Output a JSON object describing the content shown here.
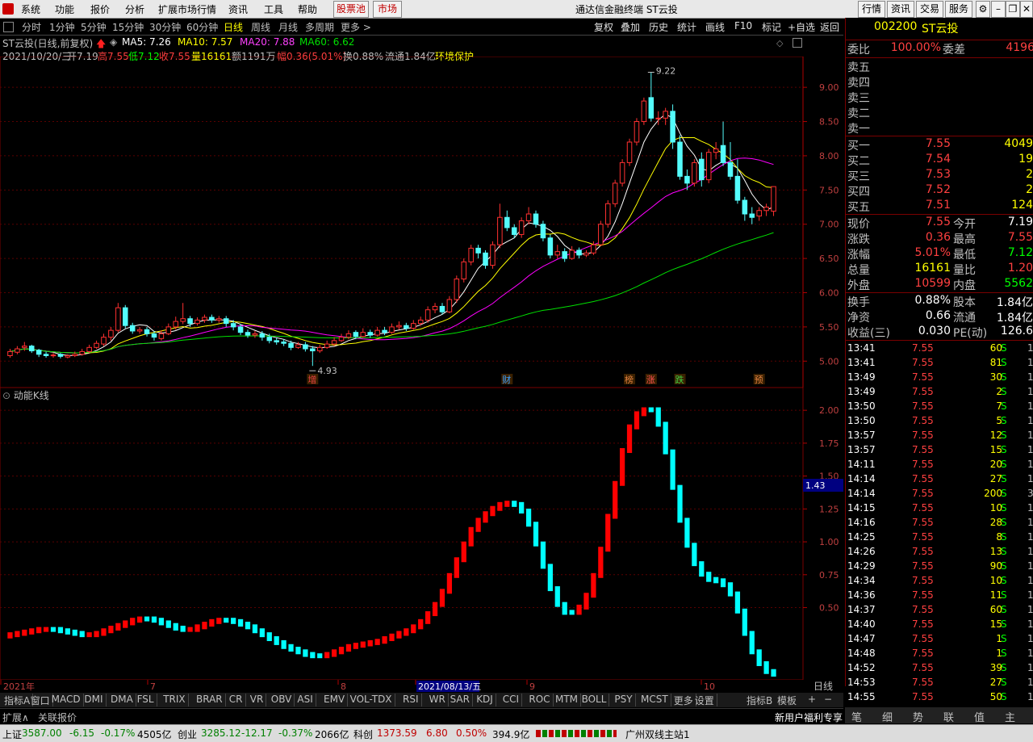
{
  "menubar": {
    "items": [
      "系统",
      "功能",
      "报价",
      "分析",
      "扩展市场行情",
      "资讯",
      "工具",
      "帮助"
    ],
    "highlight": [
      "股票池",
      "市场"
    ],
    "title": "通达信金融终端  ST云投",
    "right_buttons": [
      "行情",
      "资讯",
      "交易",
      "服务"
    ]
  },
  "toolbar": {
    "left": [
      "分时",
      "1分钟",
      "5分钟",
      "15分钟",
      "30分钟",
      "60分钟",
      "日线",
      "周线",
      "月线",
      "多周期",
      "更多 >"
    ],
    "selected": "日线",
    "right": [
      "复权",
      "叠加",
      "历史",
      "统计",
      "画线",
      "F10",
      "标记",
      "+自选",
      "返回"
    ]
  },
  "header": {
    "stock": "ST云投(日线,前复权)",
    "ma5": "MA5: 7.26",
    "ma10": "MA10: 7.57",
    "ma20": "MA20: 7.88",
    "ma60": "MA60: 6.62",
    "date": "2021/10/20/三",
    "open": "开7.19",
    "high": "高7.55",
    "low": "低7.12",
    "close": "收7.55",
    "vol": "量16161",
    "amount": "额1191万",
    "range": "幅0.36(5.01%)",
    "turnover": "换0.88%",
    "float": "流通1.84亿",
    "concept": "环境保护"
  },
  "chart_data": [
    {
      "type": "candlestick",
      "title": "ST云投(日线,前复权)",
      "ylim": [
        4.85,
        9.45
      ],
      "yticks": [
        "9.00",
        "8.50",
        "8.00",
        "7.50",
        "7.00",
        "6.50",
        "6.00",
        "5.50",
        "5.00"
      ],
      "annotations": {
        "high": "9.22",
        "low": "4.93"
      },
      "event_labels": [
        "增",
        "财",
        "榜",
        "涨",
        "跌",
        "预"
      ],
      "ma_legend": [
        "MA5",
        "MA10",
        "MA20",
        "MA60"
      ],
      "colors": {
        "up": "#ff3030",
        "down": "#54fcfc",
        "ma5": "#ffffff",
        "ma10": "#ffff00",
        "ma20": "#ff00ff",
        "ma60": "#00e000"
      },
      "closes": [
        5.14,
        5.18,
        5.22,
        5.15,
        5.1,
        5.08,
        5.09,
        5.07,
        5.08,
        5.1,
        5.14,
        5.2,
        5.26,
        5.35,
        5.45,
        5.78,
        5.52,
        5.44,
        5.46,
        5.4,
        5.35,
        5.4,
        5.5,
        5.58,
        5.62,
        5.55,
        5.6,
        5.64,
        5.6,
        5.62,
        5.55,
        5.5,
        5.42,
        5.38,
        5.4,
        5.35,
        5.3,
        5.28,
        5.26,
        5.2,
        5.24,
        5.18,
        5.15,
        5.2,
        5.25,
        5.3,
        5.35,
        5.4,
        5.36,
        5.42,
        5.38,
        5.45,
        5.42,
        5.5,
        5.52,
        5.48,
        5.55,
        5.6,
        5.75,
        5.8,
        5.72,
        5.9,
        6.2,
        6.45,
        6.65,
        6.58,
        6.4,
        6.7,
        7.1,
        6.95,
        6.85,
        7.05,
        7.15,
        7.0,
        6.8,
        6.55,
        6.6,
        6.5,
        6.62,
        6.55,
        6.58,
        6.7,
        7.0,
        7.3,
        7.6,
        7.9,
        8.2,
        8.5,
        8.8,
        8.55,
        8.55,
        8.65,
        8.2,
        7.7,
        7.6,
        7.9,
        7.65,
        8.05,
        8.1,
        7.9,
        7.7,
        7.35,
        7.15,
        7.1,
        7.2,
        7.25,
        7.55
      ],
      "opens": [
        5.08,
        5.13,
        5.2,
        5.22,
        5.16,
        5.1,
        5.08,
        5.1,
        5.06,
        5.08,
        5.1,
        5.14,
        5.2,
        5.25,
        5.35,
        5.45,
        5.78,
        5.52,
        5.44,
        5.46,
        5.4,
        5.33,
        5.4,
        5.5,
        5.58,
        5.62,
        5.55,
        5.6,
        5.64,
        5.6,
        5.62,
        5.55,
        5.5,
        5.42,
        5.38,
        5.4,
        5.35,
        5.3,
        5.28,
        5.26,
        5.2,
        5.24,
        5.18,
        5.15,
        5.2,
        5.25,
        5.3,
        5.35,
        5.42,
        5.36,
        5.42,
        5.38,
        5.45,
        5.42,
        5.5,
        5.52,
        5.48,
        5.55,
        5.6,
        5.75,
        5.8,
        5.72,
        5.9,
        6.2,
        6.45,
        6.65,
        6.58,
        6.4,
        6.7,
        7.1,
        6.95,
        6.85,
        7.05,
        7.15,
        7.0,
        6.8,
        6.55,
        6.6,
        6.5,
        6.62,
        6.55,
        6.58,
        6.7,
        7.0,
        7.3,
        7.6,
        7.9,
        8.2,
        8.5,
        8.85,
        8.55,
        8.55,
        8.65,
        8.2,
        7.7,
        7.6,
        7.95,
        7.65,
        8.05,
        8.15,
        7.9,
        7.7,
        7.35,
        7.15,
        7.12,
        7.2,
        7.19
      ],
      "highs": [
        5.18,
        5.22,
        5.28,
        5.24,
        5.18,
        5.14,
        5.12,
        5.12,
        5.1,
        5.14,
        5.18,
        5.24,
        5.3,
        5.4,
        5.5,
        5.85,
        5.82,
        5.56,
        5.5,
        5.5,
        5.44,
        5.45,
        5.55,
        5.65,
        5.85,
        5.66,
        5.64,
        5.68,
        5.68,
        5.66,
        5.66,
        5.6,
        5.54,
        5.46,
        5.44,
        5.44,
        5.4,
        5.34,
        5.32,
        5.3,
        5.28,
        5.28,
        5.22,
        5.24,
        5.3,
        5.35,
        5.4,
        5.45,
        5.45,
        5.48,
        5.46,
        5.5,
        5.5,
        5.55,
        5.58,
        5.56,
        5.6,
        5.65,
        5.8,
        5.85,
        5.85,
        5.95,
        6.25,
        6.5,
        6.7,
        6.7,
        6.62,
        6.75,
        7.3,
        7.2,
        7.0,
        7.1,
        7.25,
        7.2,
        7.05,
        6.85,
        6.7,
        6.65,
        6.68,
        6.66,
        6.62,
        6.75,
        7.05,
        7.35,
        7.65,
        7.95,
        8.25,
        8.55,
        8.85,
        9.22,
        8.65,
        8.7,
        8.75,
        8.3,
        7.8,
        7.95,
        8.05,
        8.1,
        8.2,
        8.5,
        8.2,
        7.95,
        7.4,
        7.25,
        7.25,
        7.3,
        7.55
      ],
      "lows": [
        5.05,
        5.1,
        5.15,
        5.12,
        5.06,
        5.05,
        5.05,
        5.04,
        5.04,
        5.06,
        5.08,
        5.12,
        5.18,
        5.22,
        5.3,
        5.42,
        5.48,
        5.4,
        5.4,
        5.36,
        5.3,
        5.3,
        5.38,
        5.46,
        5.54,
        5.5,
        5.52,
        5.56,
        5.56,
        5.56,
        5.5,
        5.45,
        5.38,
        5.34,
        5.34,
        5.3,
        5.26,
        5.24,
        5.22,
        5.16,
        5.18,
        5.14,
        4.93,
        5.12,
        5.18,
        5.22,
        5.28,
        5.32,
        5.32,
        5.34,
        5.34,
        5.36,
        5.38,
        5.4,
        5.46,
        5.44,
        5.46,
        5.52,
        5.56,
        5.7,
        5.68,
        5.7,
        5.85,
        6.15,
        6.4,
        6.5,
        6.35,
        6.35,
        6.65,
        6.9,
        6.8,
        6.8,
        7.0,
        6.95,
        6.75,
        6.5,
        6.5,
        6.45,
        6.48,
        6.5,
        6.52,
        6.55,
        6.68,
        6.95,
        7.25,
        7.55,
        7.85,
        8.15,
        8.45,
        8.5,
        8.45,
        8.45,
        8.1,
        7.65,
        7.5,
        7.55,
        7.55,
        7.6,
        7.95,
        7.85,
        7.65,
        7.3,
        7.05,
        7.0,
        7.05,
        7.12,
        7.12
      ]
    },
    {
      "type": "bar",
      "title": "动能K线",
      "ylim": [
        0.0,
        2.05
      ],
      "yticks": [
        "2.00",
        "1.75",
        "1.50",
        "1.25",
        "1.00",
        "0.75",
        "0.50"
      ],
      "marker": "1.43",
      "colors": {
        "rising": "#ff0000",
        "falling": "#00ffff"
      },
      "values": [
        0.3,
        0.31,
        0.32,
        0.33,
        0.34,
        0.34,
        0.34,
        0.33,
        0.32,
        0.31,
        0.3,
        0.3,
        0.31,
        0.33,
        0.35,
        0.37,
        0.39,
        0.41,
        0.42,
        0.42,
        0.41,
        0.39,
        0.37,
        0.35,
        0.34,
        0.34,
        0.36,
        0.38,
        0.4,
        0.41,
        0.41,
        0.4,
        0.38,
        0.36,
        0.33,
        0.3,
        0.27,
        0.24,
        0.21,
        0.19,
        0.17,
        0.15,
        0.14,
        0.14,
        0.15,
        0.17,
        0.19,
        0.21,
        0.22,
        0.23,
        0.24,
        0.25,
        0.27,
        0.29,
        0.31,
        0.33,
        0.36,
        0.4,
        0.46,
        0.53,
        0.63,
        0.75,
        0.87,
        0.99,
        1.1,
        1.17,
        1.22,
        1.26,
        1.29,
        1.3,
        1.29,
        1.24,
        1.14,
        0.99,
        0.82,
        0.65,
        0.53,
        0.47,
        0.47,
        0.51,
        0.6,
        0.75,
        0.95,
        1.2,
        1.45,
        1.7,
        1.88,
        1.98,
        2.01,
        2.01,
        1.9,
        1.69,
        1.42,
        1.17,
        0.98,
        0.84,
        0.76,
        0.72,
        0.71,
        0.68,
        0.61,
        0.48,
        0.31,
        0.17,
        0.08,
        0.02,
        0.0
      ],
      "signal": [
        1,
        1,
        1,
        1,
        1,
        1,
        0,
        0,
        0,
        0,
        0,
        1,
        1,
        1,
        1,
        1,
        1,
        1,
        1,
        0,
        0,
        0,
        0,
        0,
        0,
        1,
        1,
        1,
        1,
        1,
        0,
        0,
        0,
        0,
        0,
        0,
        0,
        0,
        0,
        0,
        0,
        0,
        0,
        0,
        1,
        1,
        1,
        1,
        1,
        1,
        1,
        1,
        1,
        1,
        1,
        1,
        1,
        1,
        1,
        1,
        1,
        1,
        1,
        1,
        1,
        1,
        1,
        1,
        1,
        1,
        0,
        0,
        0,
        0,
        0,
        0,
        0,
        0,
        0,
        1,
        1,
        1,
        1,
        1,
        1,
        1,
        1,
        1,
        1,
        0,
        0,
        0,
        0,
        0,
        0,
        0,
        0,
        0,
        0,
        0,
        0,
        0,
        0,
        0,
        0,
        0,
        0
      ]
    }
  ],
  "xaxis": {
    "labels": [
      "2021年",
      "7",
      "8",
      "2021/08/13/五",
      "9",
      "10"
    ],
    "period": "日线"
  },
  "subchart": {
    "title": "动能K线"
  },
  "indicators": [
    "指标A",
    "窗口",
    "MACD",
    "DMI",
    "DMA",
    "FSL",
    "TRIX",
    "BRAR",
    "CR",
    "VR",
    "OBV",
    "ASI",
    "EMV",
    "VOL-TDX",
    "RSI",
    "WR",
    "SAR",
    "KDJ",
    "CCI",
    "ROC",
    "MTM",
    "BOLL",
    "PSY",
    "MCST",
    "更多",
    "设置"
  ],
  "indicators_right": [
    "指标B",
    "模板",
    "+",
    "−"
  ],
  "ext_tabs": [
    "扩展∧",
    "关联报价"
  ],
  "quote": {
    "code": "002200",
    "name": "ST云投",
    "webi_label": "委比",
    "webi": "100.00%",
    "weicha_label": "委差",
    "weicha": "4196",
    "sells": [
      {
        "label": "卖五"
      },
      {
        "label": "卖四"
      },
      {
        "label": "卖三"
      },
      {
        "label": "卖二"
      },
      {
        "label": "卖一"
      }
    ],
    "buys": [
      {
        "label": "买一",
        "price": "7.55",
        "vol": "4049"
      },
      {
        "label": "买二",
        "price": "7.54",
        "vol": "19"
      },
      {
        "label": "买三",
        "price": "7.53",
        "vol": "2"
      },
      {
        "label": "买四",
        "price": "7.52",
        "vol": "2"
      },
      {
        "label": "买五",
        "price": "7.51",
        "vol": "124"
      }
    ],
    "stats": [
      {
        "l1": "现价",
        "v1": "7.55",
        "l2": "今开",
        "v2": "7.19",
        "c1": "#ff4040",
        "c2": "#ffffff"
      },
      {
        "l1": "涨跌",
        "v1": "0.36",
        "l2": "最高",
        "v2": "7.55",
        "c1": "#ff4040",
        "c2": "#ff4040"
      },
      {
        "l1": "涨幅",
        "v1": "5.01%",
        "l2": "最低",
        "v2": "7.12",
        "c1": "#ff4040",
        "c2": "#00ff00"
      },
      {
        "l1": "总量",
        "v1": "16161",
        "l2": "量比",
        "v2": "1.20",
        "c1": "#ffff00",
        "c2": "#ff4040"
      },
      {
        "l1": "外盘",
        "v1": "10599",
        "l2": "内盘",
        "v2": "5562",
        "c1": "#ff4040",
        "c2": "#00ff00"
      }
    ],
    "stats2": [
      {
        "l1": "换手",
        "v1": "0.88%",
        "l2": "股本",
        "v2": "1.84亿"
      },
      {
        "l1": "净资",
        "v1": "0.66",
        "l2": "流通",
        "v2": "1.84亿"
      },
      {
        "l1": "收益(三)",
        "v1": "0.030",
        "l2": "PE(动)",
        "v2": "126.6"
      }
    ],
    "ticks": [
      {
        "t": "13:41",
        "p": "7.55",
        "v": "60",
        "s": "S",
        "n": "1"
      },
      {
        "t": "13:41",
        "p": "7.55",
        "v": "81",
        "s": "S",
        "n": "1"
      },
      {
        "t": "13:49",
        "p": "7.55",
        "v": "30",
        "s": "S",
        "n": "1"
      },
      {
        "t": "13:49",
        "p": "7.55",
        "v": "2",
        "s": "S",
        "n": "1"
      },
      {
        "t": "13:50",
        "p": "7.55",
        "v": "7",
        "s": "S",
        "n": "1"
      },
      {
        "t": "13:50",
        "p": "7.55",
        "v": "5",
        "s": "S",
        "n": "1"
      },
      {
        "t": "13:57",
        "p": "7.55",
        "v": "12",
        "s": "S",
        "n": "1"
      },
      {
        "t": "13:57",
        "p": "7.55",
        "v": "15",
        "s": "S",
        "n": "1"
      },
      {
        "t": "14:11",
        "p": "7.55",
        "v": "20",
        "s": "S",
        "n": "1"
      },
      {
        "t": "14:14",
        "p": "7.55",
        "v": "27",
        "s": "S",
        "n": "1"
      },
      {
        "t": "14:14",
        "p": "7.55",
        "v": "200",
        "s": "S",
        "n": "3"
      },
      {
        "t": "14:15",
        "p": "7.55",
        "v": "10",
        "s": "S",
        "n": "1"
      },
      {
        "t": "14:16",
        "p": "7.55",
        "v": "28",
        "s": "S",
        "n": "1"
      },
      {
        "t": "14:25",
        "p": "7.55",
        "v": "8",
        "s": "S",
        "n": "1"
      },
      {
        "t": "14:26",
        "p": "7.55",
        "v": "13",
        "s": "S",
        "n": "1"
      },
      {
        "t": "14:29",
        "p": "7.55",
        "v": "90",
        "s": "S",
        "n": "1"
      },
      {
        "t": "14:34",
        "p": "7.55",
        "v": "10",
        "s": "S",
        "n": "1"
      },
      {
        "t": "14:36",
        "p": "7.55",
        "v": "11",
        "s": "S",
        "n": "1"
      },
      {
        "t": "14:37",
        "p": "7.55",
        "v": "60",
        "s": "S",
        "n": "1"
      },
      {
        "t": "14:40",
        "p": "7.55",
        "v": "15",
        "s": "S",
        "n": "1"
      },
      {
        "t": "14:47",
        "p": "7.55",
        "v": "1",
        "s": "S",
        "n": "1"
      },
      {
        "t": "14:48",
        "p": "7.55",
        "v": "1",
        "s": "S",
        "n": "1"
      },
      {
        "t": "14:52",
        "p": "7.55",
        "v": "39",
        "s": "S",
        "n": "1"
      },
      {
        "t": "14:53",
        "p": "7.55",
        "v": "27",
        "s": "S",
        "n": "1"
      },
      {
        "t": "14:55",
        "p": "7.55",
        "v": "50",
        "s": "S",
        "n": "1"
      }
    ],
    "bottom_tabs": [
      "笔",
      "细",
      "势",
      "联",
      "值",
      "主"
    ]
  },
  "promo": "新用户福利专享",
  "statusbar": {
    "sh_label": "上证",
    "sh": "3587.00",
    "sh_chg": "-6.15",
    "sh_pct": "-0.17%",
    "sh_amt": "4505亿",
    "cy_label": "创业",
    "cy": "3285.12",
    "cy_chg": "-12.17",
    "cy_pct": "-0.37%",
    "cy_amt": "2066亿",
    "kc_label": "科创",
    "kc": "1373.59",
    "kc_chg": "6.80",
    "kc_pct": "0.50%",
    "kc_amt": "394.9亿",
    "site": "广州双线主站1"
  }
}
